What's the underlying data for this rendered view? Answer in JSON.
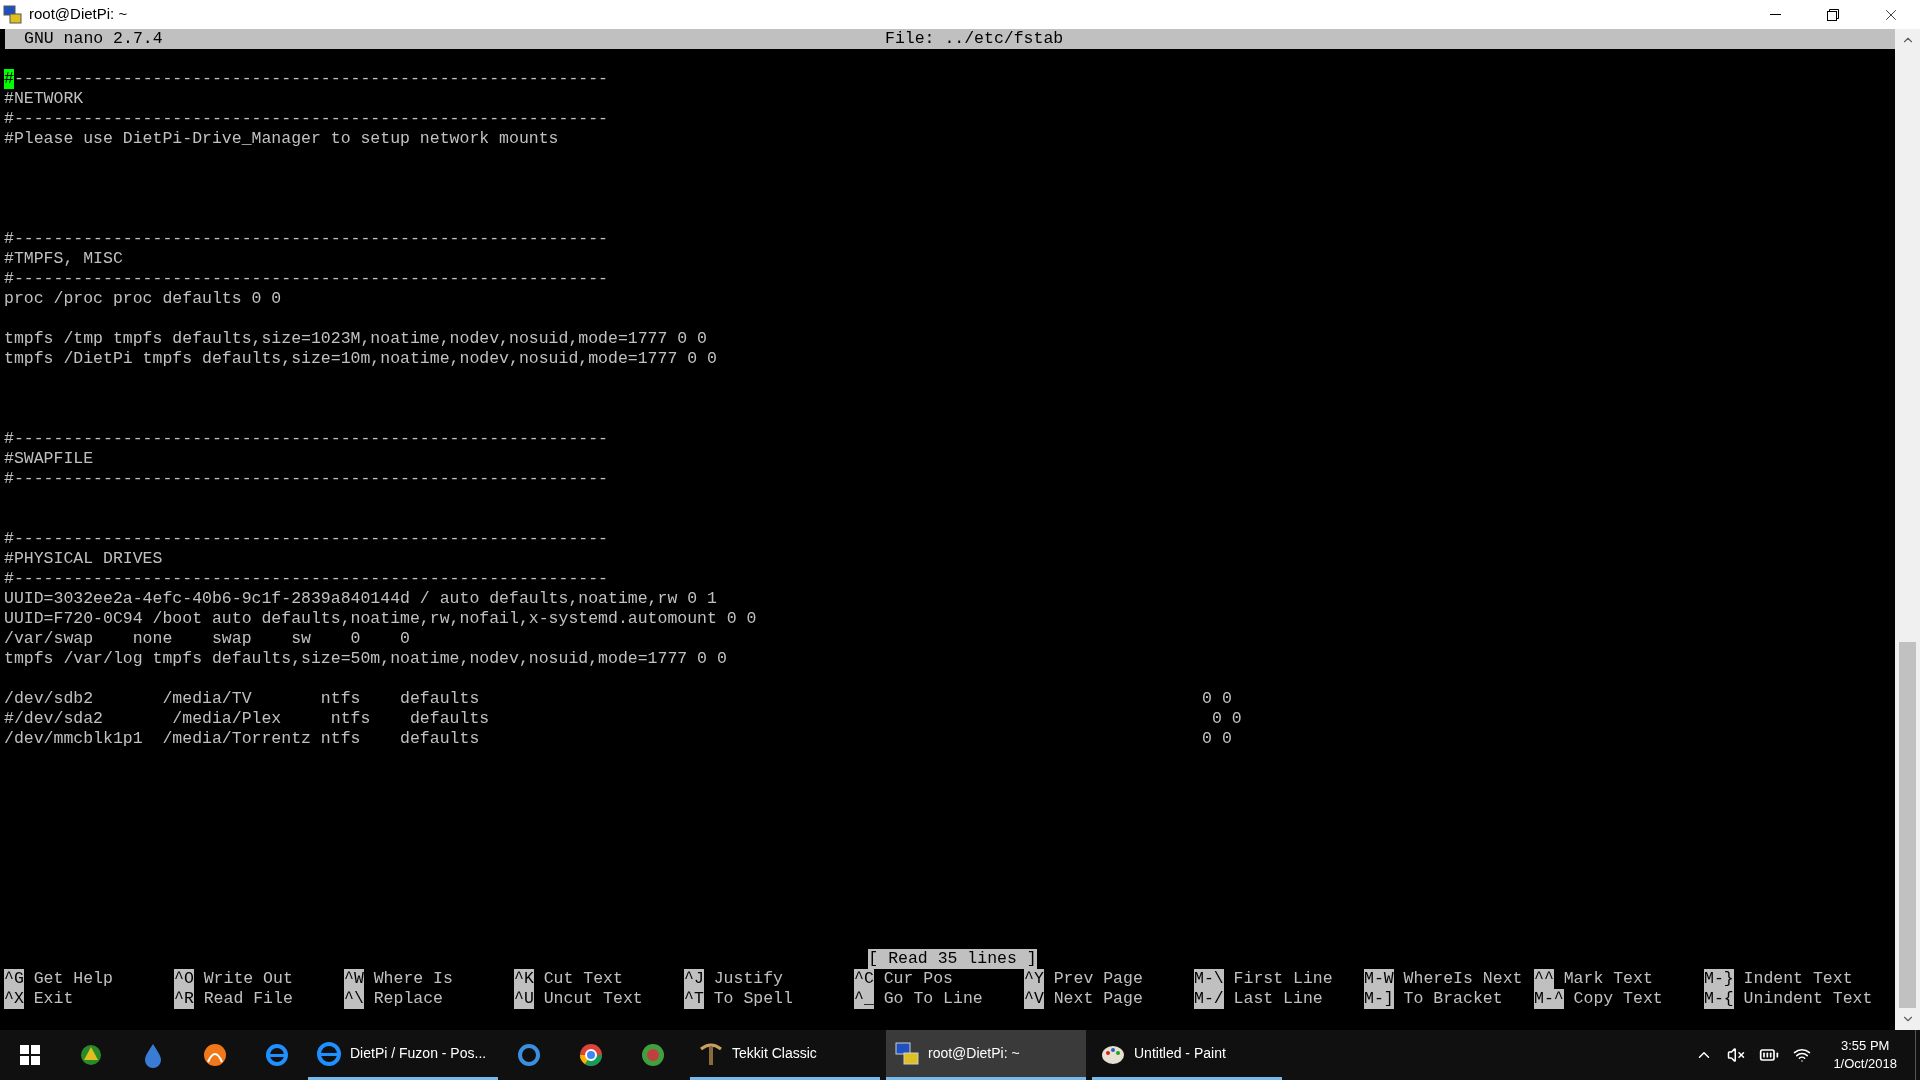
{
  "window": {
    "title": "root@DietPi: ~"
  },
  "nano": {
    "header": {
      "app": "GNU nano 2.7.4",
      "file": "File: ../etc/fstab"
    },
    "lines": [
      {
        "kind": "text",
        "text": "#------------------------------------------------------------",
        "cursor": true
      },
      {
        "kind": "text",
        "text": "#NETWORK",
        "cursor": false
      },
      {
        "kind": "text",
        "text": "#------------------------------------------------------------",
        "cursor": false
      },
      {
        "kind": "text",
        "text": "#Please use DietPi-Drive_Manager to setup network mounts",
        "cursor": false
      },
      {
        "kind": "blank"
      },
      {
        "kind": "blank"
      },
      {
        "kind": "blank"
      },
      {
        "kind": "blank"
      },
      {
        "kind": "text",
        "text": "#------------------------------------------------------------",
        "cursor": false
      },
      {
        "kind": "text",
        "text": "#TMPFS, MISC",
        "cursor": false
      },
      {
        "kind": "text",
        "text": "#------------------------------------------------------------",
        "cursor": false
      },
      {
        "kind": "text",
        "text": "proc /proc proc defaults 0 0",
        "cursor": false
      },
      {
        "kind": "blank"
      },
      {
        "kind": "text",
        "text": "tmpfs /tmp tmpfs defaults,size=1023M,noatime,nodev,nosuid,mode=1777 0 0",
        "cursor": false
      },
      {
        "kind": "text",
        "text": "tmpfs /DietPi tmpfs defaults,size=10m,noatime,nodev,nosuid,mode=1777 0 0",
        "cursor": false
      },
      {
        "kind": "blank"
      },
      {
        "kind": "blank"
      },
      {
        "kind": "blank"
      },
      {
        "kind": "text",
        "text": "#------------------------------------------------------------",
        "cursor": false
      },
      {
        "kind": "text",
        "text": "#SWAPFILE",
        "cursor": false
      },
      {
        "kind": "text",
        "text": "#------------------------------------------------------------",
        "cursor": false
      },
      {
        "kind": "blank"
      },
      {
        "kind": "blank"
      },
      {
        "kind": "text",
        "text": "#------------------------------------------------------------",
        "cursor": false
      },
      {
        "kind": "text",
        "text": "#PHYSICAL DRIVES",
        "cursor": false
      },
      {
        "kind": "text",
        "text": "#------------------------------------------------------------",
        "cursor": false
      },
      {
        "kind": "text",
        "text": "UUID=3032ee2a-4efc-40b6-9c1f-2839a840144d / auto defaults,noatime,rw 0 1",
        "cursor": false
      },
      {
        "kind": "text",
        "text": "UUID=F720-0C94 /boot auto defaults,noatime,rw,nofail,x-systemd.automount 0 0",
        "cursor": false
      },
      {
        "kind": "text",
        "text": "/var/swap    none    swap    sw    0    0",
        "cursor": false
      },
      {
        "kind": "text",
        "text": "tmpfs /var/log tmpfs defaults,size=50m,noatime,nodev,nosuid,mode=1777 0 0",
        "cursor": false
      },
      {
        "kind": "blank"
      },
      {
        "kind": "text",
        "text": "/dev/sdb2       /media/TV       ntfs    defaults                                                                         0 0",
        "cursor": false
      },
      {
        "kind": "text",
        "text": "#/dev/sda2       /media/Plex     ntfs    defaults                                                                         0 0",
        "cursor": false
      },
      {
        "kind": "text",
        "text": "/dev/mmcblk1p1  /media/Torrentz ntfs    defaults                                                                         0 0",
        "cursor": false
      }
    ],
    "status": "[ Read 35 lines ]",
    "shortcut_rows": [
      [
        {
          "key": "^G",
          "label": "Get Help"
        },
        {
          "key": "^O",
          "label": "Write Out"
        },
        {
          "key": "^W",
          "label": "Where Is"
        },
        {
          "key": "^K",
          "label": "Cut Text"
        },
        {
          "key": "^J",
          "label": "Justify"
        },
        {
          "key": "^C",
          "label": "Cur Pos"
        },
        {
          "key": "^Y",
          "label": "Prev Page"
        },
        {
          "key": "M-\\",
          "label": "First Line"
        },
        {
          "key": "M-W",
          "label": "WhereIs Next"
        },
        {
          "key": "^^",
          "label": "Mark Text"
        },
        {
          "key": "M-}",
          "label": "Indent Text"
        }
      ],
      [
        {
          "key": "^X",
          "label": "Exit"
        },
        {
          "key": "^R",
          "label": "Read File"
        },
        {
          "key": "^\\",
          "label": "Replace"
        },
        {
          "key": "^U",
          "label": "Uncut Text"
        },
        {
          "key": "^T",
          "label": "To Spell"
        },
        {
          "key": "^_",
          "label": "Go To Line"
        },
        {
          "key": "^V",
          "label": "Next Page"
        },
        {
          "key": "M-/",
          "label": "Last Line"
        },
        {
          "key": "M-]",
          "label": "To Bracket"
        },
        {
          "key": "M-^",
          "label": "Copy Text"
        },
        {
          "key": "M-{",
          "label": "Unindent Text"
        }
      ]
    ]
  },
  "taskbar": {
    "apps": [
      {
        "label": "DietPi / Fuzon - Pos...",
        "selected": false,
        "open": true
      },
      {
        "label": "Tekkit Classic",
        "selected": false,
        "open": true
      },
      {
        "label": "root@DietPi: ~",
        "selected": true,
        "open": true
      },
      {
        "label": "Untitled - Paint",
        "selected": false,
        "open": true
      }
    ],
    "time": "3:55 PM",
    "date": "1/Oct/2018"
  }
}
